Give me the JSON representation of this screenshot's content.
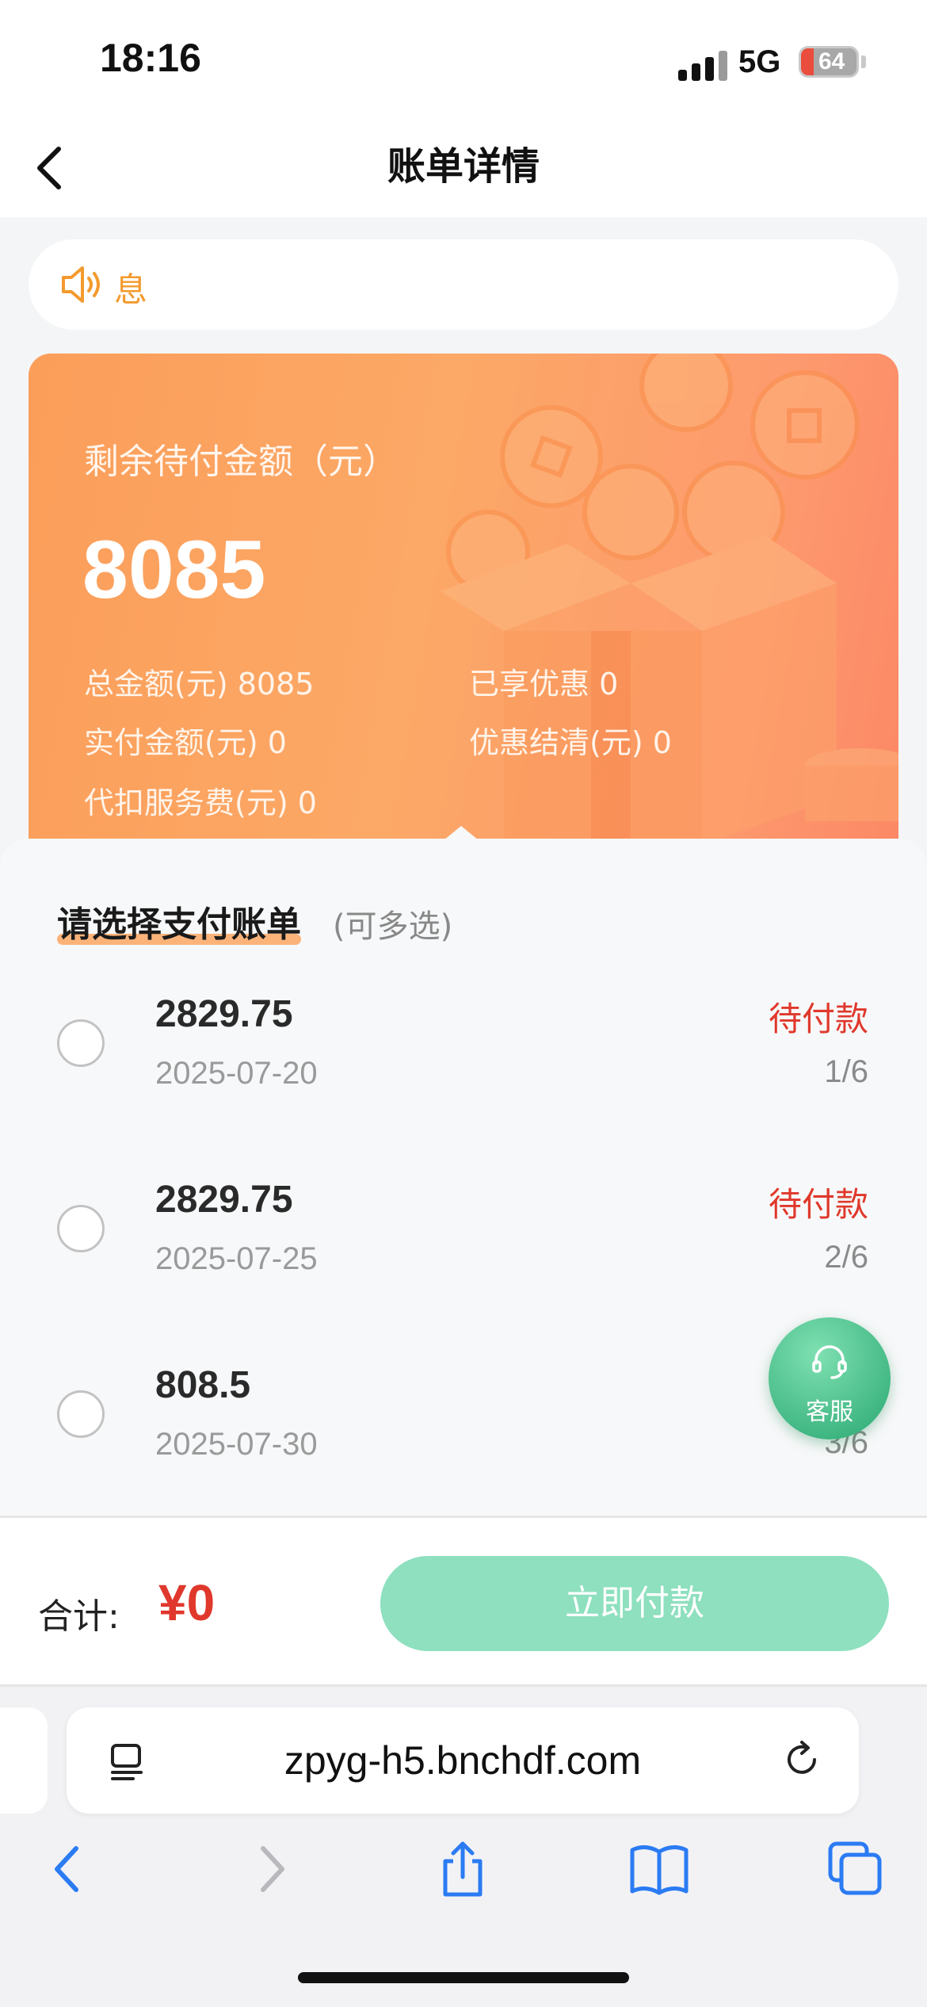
{
  "status_bar": {
    "time": "18:16",
    "network": "5G",
    "battery": "64"
  },
  "nav": {
    "title": "账单详情"
  },
  "notice": {
    "text": "息"
  },
  "summary": {
    "label": "剩余待付金额（元）",
    "amount": "8085",
    "total": "总金额(元) 8085",
    "discount": "已享优惠 0",
    "paid": "实付金额(元) 0",
    "discount_settled": "优惠结清(元) 0",
    "service_fee": "代扣服务费(元) 0"
  },
  "bill_list": {
    "title": "请选择支付账单",
    "subtitle": "(可多选)",
    "items": [
      {
        "amount": "2829.75",
        "date": "2025-07-20",
        "status": "待付款",
        "period": "1/6",
        "selected": false
      },
      {
        "amount": "2829.75",
        "date": "2025-07-25",
        "status": "待付款",
        "period": "2/6",
        "selected": false
      },
      {
        "amount": "808.5",
        "date": "2025-07-30",
        "status": "",
        "period": "3/6",
        "selected": false
      }
    ]
  },
  "service": {
    "label": "客服"
  },
  "footer": {
    "total_label": "合计:",
    "total_amount": "¥0",
    "pay_label": "立即付款"
  },
  "browser": {
    "url": "zpyg-h5.bnchdf.com"
  },
  "colors": {
    "accent_orange": "#fca866",
    "status_red": "#e0382c",
    "pay_green": "#8ee0bf",
    "service_green": "#3ab37e"
  }
}
